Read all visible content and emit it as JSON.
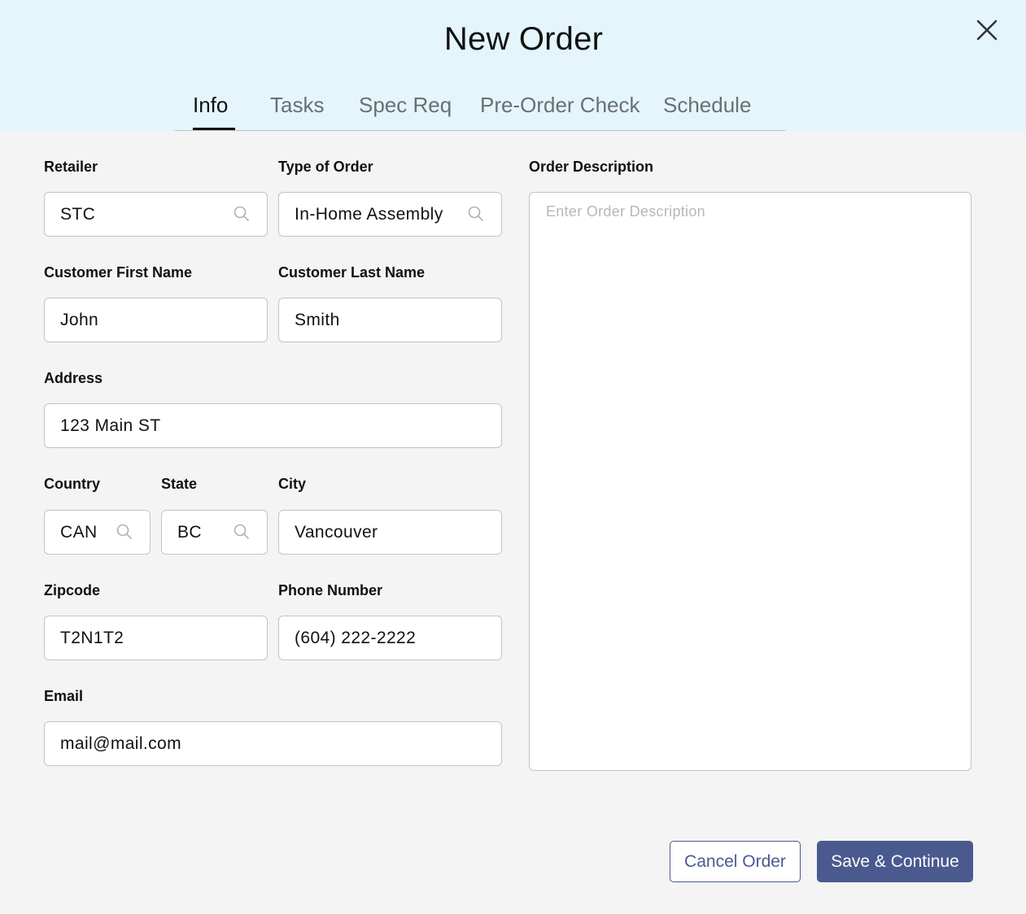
{
  "dialog": {
    "title": "New Order",
    "close_icon": "close-icon"
  },
  "tabs": [
    {
      "label": "Info",
      "active": true
    },
    {
      "label": "Tasks",
      "active": false
    },
    {
      "label": "Spec Req",
      "active": false
    },
    {
      "label": "Pre-Order Check",
      "active": false
    },
    {
      "label": "Schedule",
      "active": false
    }
  ],
  "form": {
    "retailer": {
      "label": "Retailer",
      "value": "STC",
      "icon": "search-icon"
    },
    "order_type": {
      "label": "Type of Order",
      "value": "In-Home Assembly",
      "icon": "search-icon"
    },
    "first_name": {
      "label": "Customer First Name",
      "value": "John"
    },
    "last_name": {
      "label": "Customer Last Name",
      "value": "Smith"
    },
    "address": {
      "label": "Address",
      "value": "123 Main ST"
    },
    "country": {
      "label": "Country",
      "value": "CAN",
      "icon": "search-icon"
    },
    "state": {
      "label": "State",
      "value": "BC",
      "icon": "search-icon"
    },
    "city": {
      "label": "City",
      "value": "Vancouver"
    },
    "zipcode": {
      "label": "Zipcode",
      "value": "T2N1T2"
    },
    "phone": {
      "label": "Phone Number",
      "value": "(604) 222-2222"
    },
    "email": {
      "label": "Email",
      "value": "mail@mail.com"
    },
    "description": {
      "label": "Order Description",
      "placeholder": "Enter Order Description",
      "value": ""
    }
  },
  "actions": {
    "cancel_label": "Cancel Order",
    "save_label": "Save & Continue"
  },
  "colors": {
    "header_bg": "#e4f6fc",
    "body_bg": "#f4f4f4",
    "primary": "#4a5a8f",
    "border": "#c4c4c4"
  }
}
